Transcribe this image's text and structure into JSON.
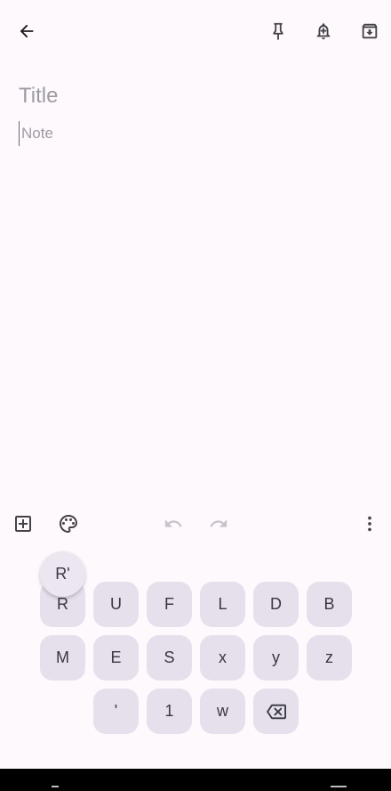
{
  "header": {
    "back_icon": "arrow-back-icon",
    "pin_icon": "pin-icon",
    "reminder_icon": "reminder-bell-icon",
    "archive_icon": "archive-icon"
  },
  "editor": {
    "title_placeholder": "Title",
    "title_value": "",
    "note_placeholder": "Note",
    "note_value": ""
  },
  "toolbar": {
    "add_icon": "add-box-icon",
    "palette_icon": "palette-icon",
    "undo_icon": "undo-icon",
    "redo_icon": "redo-icon",
    "more_icon": "more-vert-icon"
  },
  "keyboard": {
    "preview_key": "R'",
    "row1": [
      "R",
      "U",
      "F",
      "L",
      "D",
      "B"
    ],
    "row2": [
      "M",
      "E",
      "S",
      "x",
      "y",
      "z"
    ],
    "row3": [
      "'",
      "1",
      "w"
    ],
    "backspace_icon": "backspace-icon"
  },
  "colors": {
    "background": "#fdf9fd",
    "key_background": "#e6e0ec",
    "icon": "#444148",
    "disabled_icon": "#c8c3cc",
    "placeholder": "#9e9aa3",
    "nav_bar": "#000000"
  }
}
